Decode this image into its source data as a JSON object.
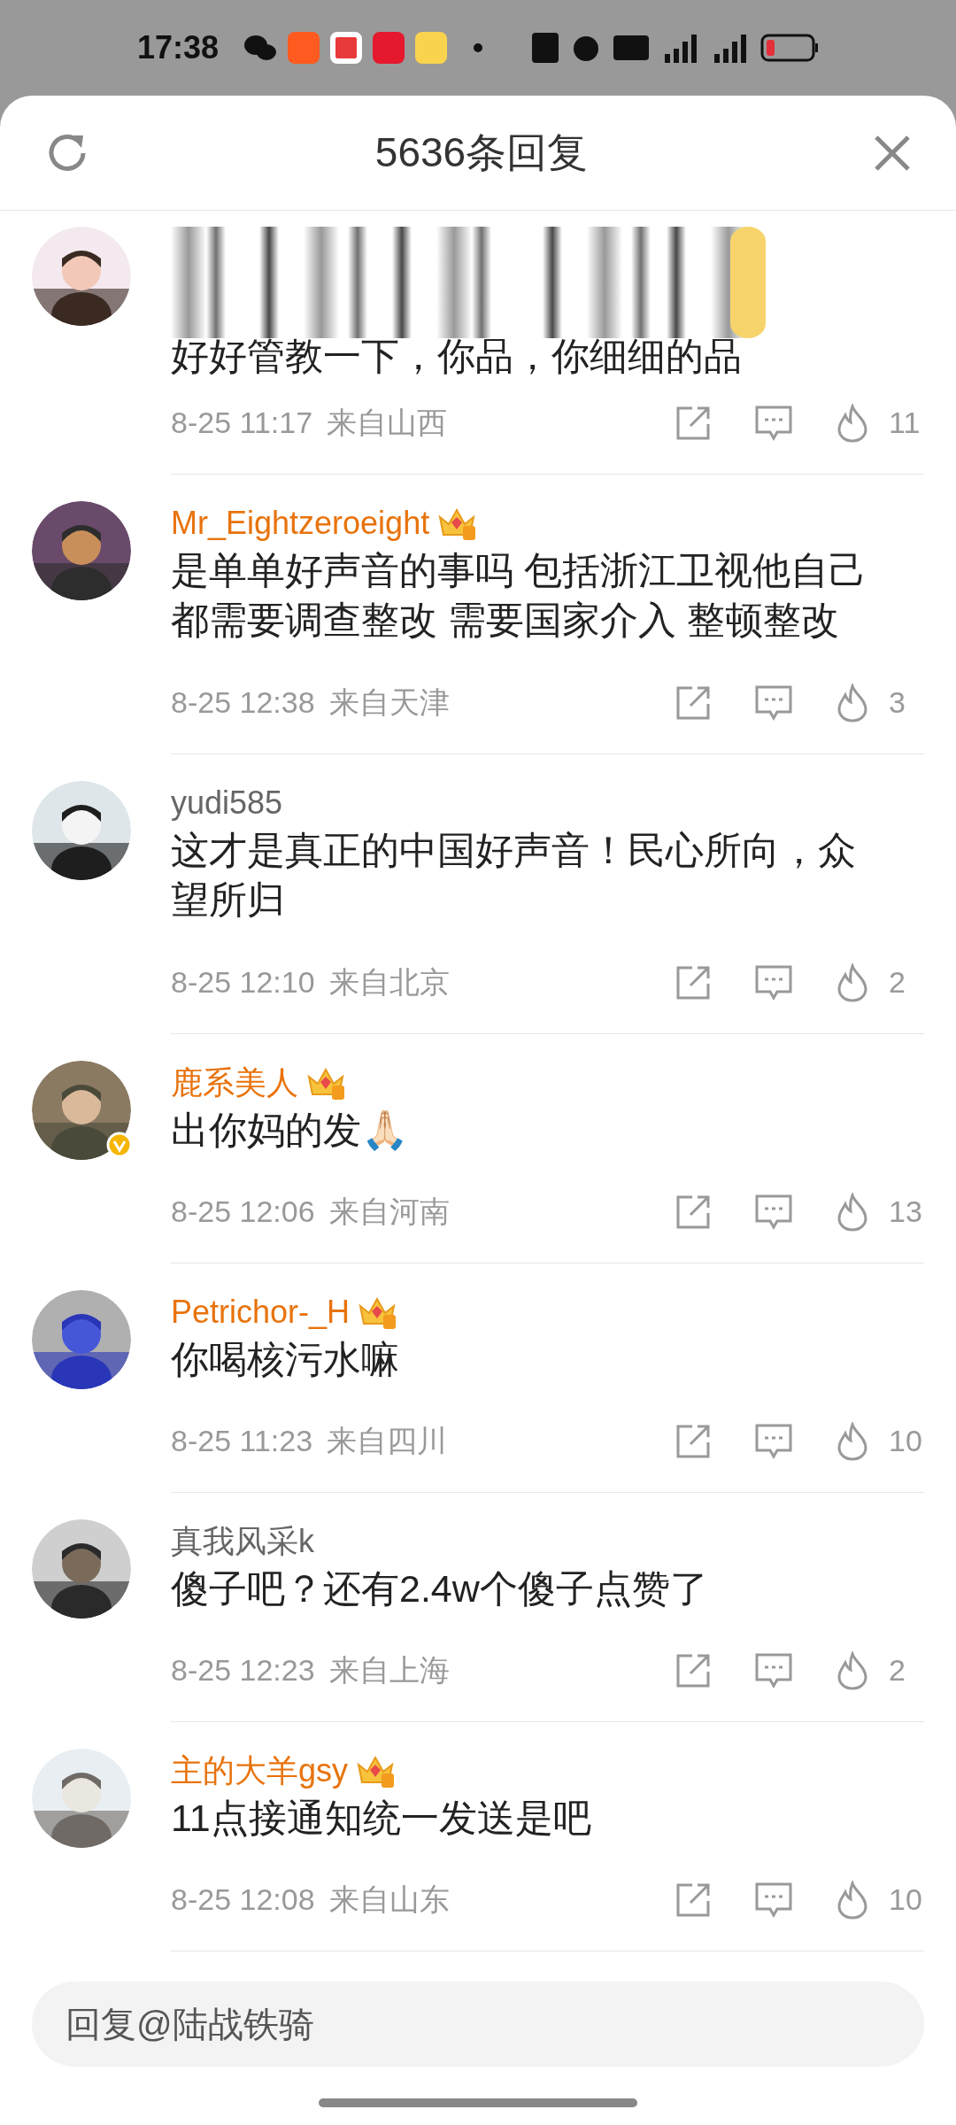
{
  "status_bar": {
    "time": "17:38"
  },
  "header": {
    "title": "5636条回复"
  },
  "comments": [
    {
      "verified": false,
      "text": "好好管教一下，你品，你细细的品",
      "obscured": true,
      "time": "8-25 11:17",
      "location": "来自山西",
      "likes": "11"
    },
    {
      "name": "Mr_Eightzeroeight",
      "vip": true,
      "verified": false,
      "text": "是单单好声音的事吗 包括浙江卫视他自己都需要调查整改 需要国家介入 整顿整改",
      "obscured": false,
      "time": "8-25 12:38",
      "location": "来自天津",
      "likes": "3"
    },
    {
      "name": "yudi585",
      "vip": false,
      "verified": false,
      "text": "这才是真正的中国好声音！民心所向，众望所归",
      "obscured": false,
      "time": "8-25 12:10",
      "location": "来自北京",
      "likes": "2"
    },
    {
      "name": "鹿系美人",
      "vip": true,
      "verified": true,
      "text": "出你妈的发🙏🏻",
      "obscured": false,
      "time": "8-25 12:06",
      "location": "来自河南",
      "likes": "13"
    },
    {
      "name": "Petrichor-_H",
      "vip": true,
      "verified": false,
      "text": "你喝核污水嘛",
      "obscured": false,
      "time": "8-25 11:23",
      "location": "来自四川",
      "likes": "10"
    },
    {
      "name": "真我风采k",
      "vip": false,
      "verified": false,
      "text": "傻子吧？还有2.4w个傻子点赞了",
      "obscured": false,
      "time": "8-25 12:23",
      "location": "来自上海",
      "likes": "2"
    },
    {
      "name": "主的大羊gsy",
      "vip": true,
      "verified": false,
      "text": "11点接通知统一发送是吧",
      "obscured": false,
      "time": "8-25 12:08",
      "location": "来自山东",
      "likes": "10"
    }
  ],
  "reply_field": {
    "placeholder": "回复@陆战铁骑"
  }
}
